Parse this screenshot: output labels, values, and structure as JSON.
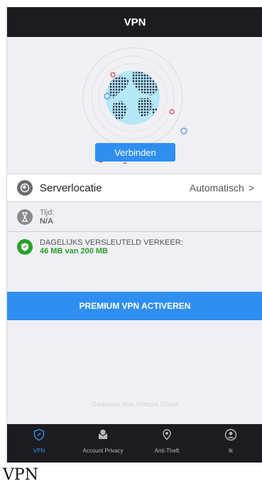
{
  "header": {
    "title": "VPN"
  },
  "main": {
    "connect_label": "Verbinden",
    "server": {
      "label": "Serverlocatie",
      "value": "Automatisch",
      "chevron": ">",
      "icon": "globe-gear-icon"
    },
    "time": {
      "label": "Tijd:",
      "value": "N/A",
      "icon": "hourglass-icon"
    },
    "traffic": {
      "label": "DAGELIJKS VERSLEUTELD VERKEER:",
      "value": "46 MB van 200 MB",
      "icon": "shield-link-icon"
    },
    "premium_label": "PREMIUM VPN ACTIVEREN",
    "footer": "Gedreven door Hotspot Shield"
  },
  "tabs": [
    {
      "label": "VPN",
      "icon": "shield-icon",
      "active": true
    },
    {
      "label": "Account Privacy",
      "icon": "mail-shield-icon",
      "active": false
    },
    {
      "label": "Anti-Theft",
      "icon": "location-pin-icon",
      "active": false
    },
    {
      "label": "Ik",
      "icon": "user-icon",
      "active": false
    }
  ],
  "caption": "VPN",
  "colors": {
    "accent": "#2e8ff0",
    "nav_background": "#1c1c20",
    "traffic_green": "#2aa02a",
    "marker_red": "#e03c3c"
  }
}
